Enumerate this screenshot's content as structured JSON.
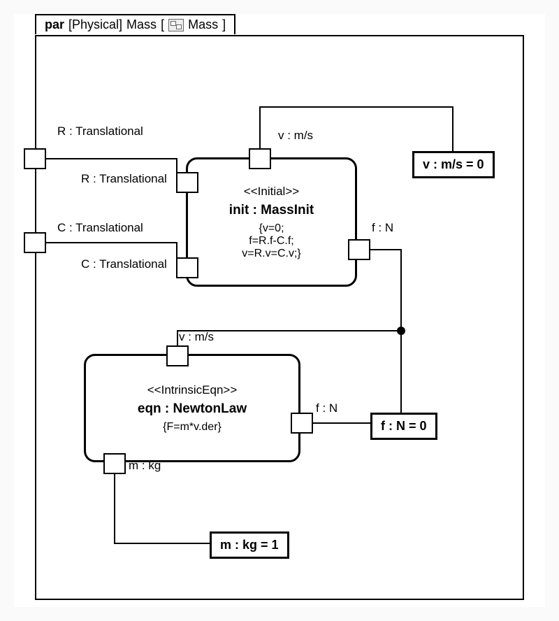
{
  "frame": {
    "kind": "par",
    "context": "[Physical]",
    "subject": "Mass",
    "innerOpen": "[",
    "innerName": "Mass",
    "innerClose": "]"
  },
  "ports": {
    "r_ext": {
      "label": "R : Translational"
    },
    "r_int": {
      "label": "R : Translational"
    },
    "c_ext": {
      "label": "C : Translational"
    },
    "c_int": {
      "label": "C : Translational"
    },
    "init_v": {
      "label": "v : m/s"
    },
    "init_f": {
      "label": "f : N"
    },
    "eqn_v": {
      "label": "v : m/s"
    },
    "eqn_f": {
      "label": "f : N"
    },
    "eqn_m": {
      "label": "m : kg"
    }
  },
  "blocks": {
    "init": {
      "stereotype": "<<Initial>>",
      "title": "init : MassInit",
      "constraint": "{v=0;\nf=R.f-C.f;\nv=R.v=C.v;}"
    },
    "eqn": {
      "stereotype": "<<IntrinsicEqn>>",
      "title": "eqn : NewtonLaw",
      "constraint": "{F=m*v.der}"
    }
  },
  "values": {
    "v0": "v : m/s = 0",
    "f0": "f : N = 0",
    "m1": "m : kg = 1"
  }
}
